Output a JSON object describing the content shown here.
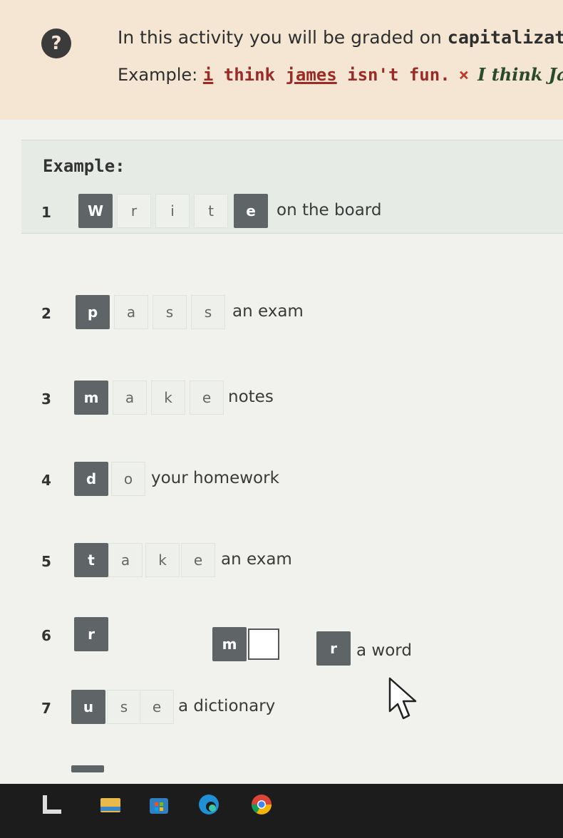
{
  "banner": {
    "help_icon": "question-mark-icon",
    "line1_prefix": "In this activity you will be graded on ",
    "line1_bold": "capitalizatio",
    "example_label": "Example: ",
    "wrong_i": "i",
    "wrong_think": " think ",
    "wrong_james": "james",
    "wrong_rest": " isn't fun.",
    "wrong_mark": "×",
    "correct": "I think Jame"
  },
  "example": {
    "label": "Example:"
  },
  "rows": [
    {
      "num": "1",
      "letters": [
        "W",
        "r",
        "i",
        "t",
        "e"
      ],
      "tail": "on the board"
    },
    {
      "num": "2",
      "letters": [
        "p",
        "a",
        "s",
        "s"
      ],
      "tail": "an exam"
    },
    {
      "num": "3",
      "letters": [
        "m",
        "a",
        "k",
        "e"
      ],
      "tail": "notes"
    },
    {
      "num": "4",
      "letters": [
        "d",
        "o"
      ],
      "tail": "your homework"
    },
    {
      "num": "5",
      "letters": [
        "t",
        "a",
        "k",
        "e"
      ],
      "tail": "an exam"
    },
    {
      "num": "6",
      "letters": [
        "r",
        "m",
        "r"
      ],
      "tail": "a word"
    },
    {
      "num": "7",
      "letters": [
        "u",
        "s",
        "e"
      ],
      "tail": "a dictionary"
    }
  ],
  "icons": {
    "cursor": "mouse-pointer-icon",
    "taskbar": [
      "start-icon",
      "file-explorer-icon",
      "store-icon",
      "edge-browser-icon",
      "chrome-browser-icon"
    ]
  },
  "colors": {
    "banner_bg": "#f4e6d3",
    "tile_filled": "#5f6467",
    "wrong_text": "#9c2a27",
    "correct_text": "#2a4b2a"
  }
}
